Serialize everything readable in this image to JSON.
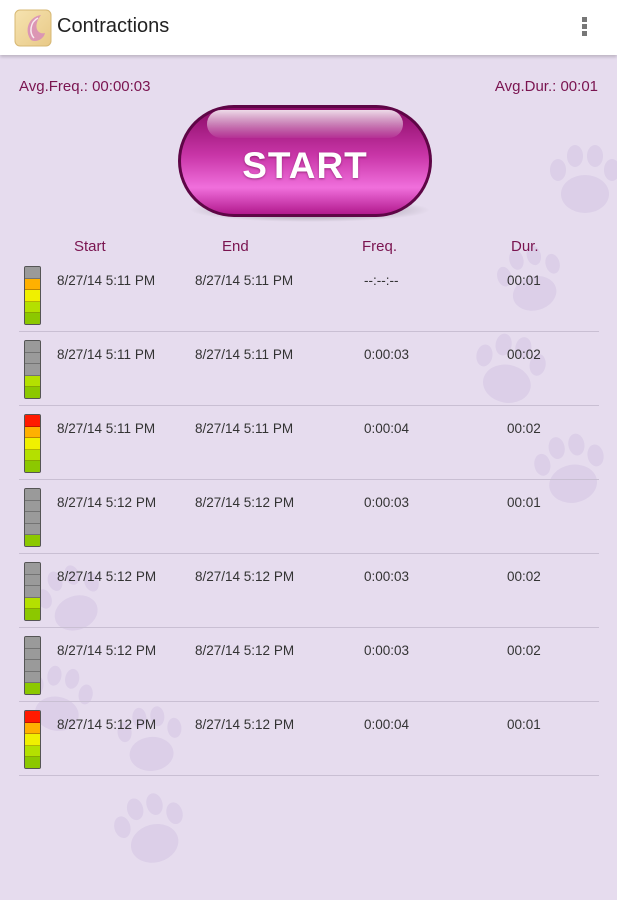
{
  "app": {
    "title": "Contractions"
  },
  "stats": {
    "avg_freq": "Avg.Freq.: 00:00:03",
    "avg_dur": "Avg.Dur.: 00:01"
  },
  "start_button": {
    "label": "START"
  },
  "columns": {
    "start": "Start",
    "end": "End",
    "freq": "Freq.",
    "dur": "Dur."
  },
  "intensity_colors": {
    "off": "#9a9a9a",
    "level1": "#8cc800",
    "level2": "#b4e000",
    "level3": "#f0f000",
    "level4": "#ffb000",
    "level5": "#ff1a00"
  },
  "rows": [
    {
      "start": "8/27/14 5:11 PM",
      "end": "8/27/14 5:11 PM",
      "freq": "--:--:--",
      "dur": "00:01",
      "intensity_levels": 4
    },
    {
      "start": "8/27/14 5:11 PM",
      "end": "8/27/14 5:11 PM",
      "freq": "0:00:03",
      "dur": "00:02",
      "intensity_levels": 2
    },
    {
      "start": "8/27/14 5:11 PM",
      "end": "8/27/14 5:11 PM",
      "freq": "0:00:04",
      "dur": "00:02",
      "intensity_levels": 5
    },
    {
      "start": "8/27/14 5:12 PM",
      "end": "8/27/14 5:12 PM",
      "freq": "0:00:03",
      "dur": "00:01",
      "intensity_levels": 1
    },
    {
      "start": "8/27/14 5:12 PM",
      "end": "8/27/14 5:12 PM",
      "freq": "0:00:03",
      "dur": "00:02",
      "intensity_levels": 2
    },
    {
      "start": "8/27/14 5:12 PM",
      "end": "8/27/14 5:12 PM",
      "freq": "0:00:03",
      "dur": "00:02",
      "intensity_levels": 1
    },
    {
      "start": "8/27/14 5:12 PM",
      "end": "8/27/14 5:12 PM",
      "freq": "0:00:04",
      "dur": "00:01",
      "intensity_levels": 5
    }
  ]
}
